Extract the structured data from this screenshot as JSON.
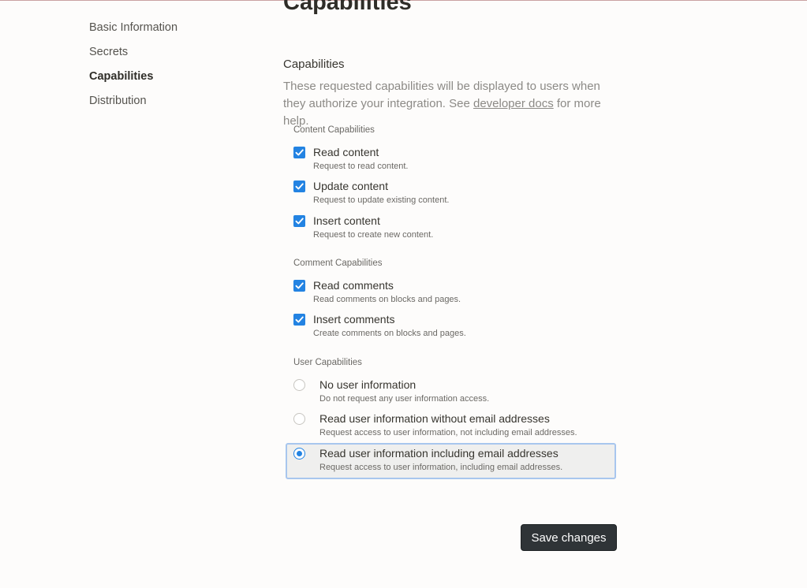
{
  "sidebar": {
    "items": [
      {
        "label": "Basic Information",
        "active": false
      },
      {
        "label": "Secrets",
        "active": false
      },
      {
        "label": "Capabilities",
        "active": true
      },
      {
        "label": "Distribution",
        "active": false
      }
    ]
  },
  "page": {
    "title": "Capabilities"
  },
  "capabilities": {
    "title": "Capabilities",
    "description_before": "These requested capabilities will be displayed to users when they authorize your integration. See ",
    "link_text": "developer docs",
    "description_after": " for more help.",
    "content_group": {
      "label": "Content Capabilities",
      "options": [
        {
          "title": "Read content",
          "subtitle": "Request to read content.",
          "checked": true
        },
        {
          "title": "Update content",
          "subtitle": "Request to update existing content.",
          "checked": true
        },
        {
          "title": "Insert content",
          "subtitle": "Request to create new content.",
          "checked": true
        }
      ]
    },
    "comment_group": {
      "label": "Comment Capabilities",
      "options": [
        {
          "title": "Read comments",
          "subtitle": "Read comments on blocks and pages.",
          "checked": true
        },
        {
          "title": "Insert comments",
          "subtitle": "Create comments on blocks and pages.",
          "checked": true
        }
      ]
    },
    "user_group": {
      "label": "User Capabilities",
      "options": [
        {
          "title": "No user information",
          "subtitle": "Do not request any user information access.",
          "selected": false
        },
        {
          "title": "Read user information without email addresses",
          "subtitle": "Request access to user information, not including email addresses.",
          "selected": false
        },
        {
          "title": "Read user information including email addresses",
          "subtitle": "Request access to user information, including email addresses.",
          "selected": true
        }
      ]
    }
  },
  "actions": {
    "save_label": "Save changes"
  },
  "colors": {
    "accent": "#2383e2",
    "button_bg": "#2f3437",
    "selected_bg": "#efefee",
    "selected_border": "#a8c6ee"
  }
}
